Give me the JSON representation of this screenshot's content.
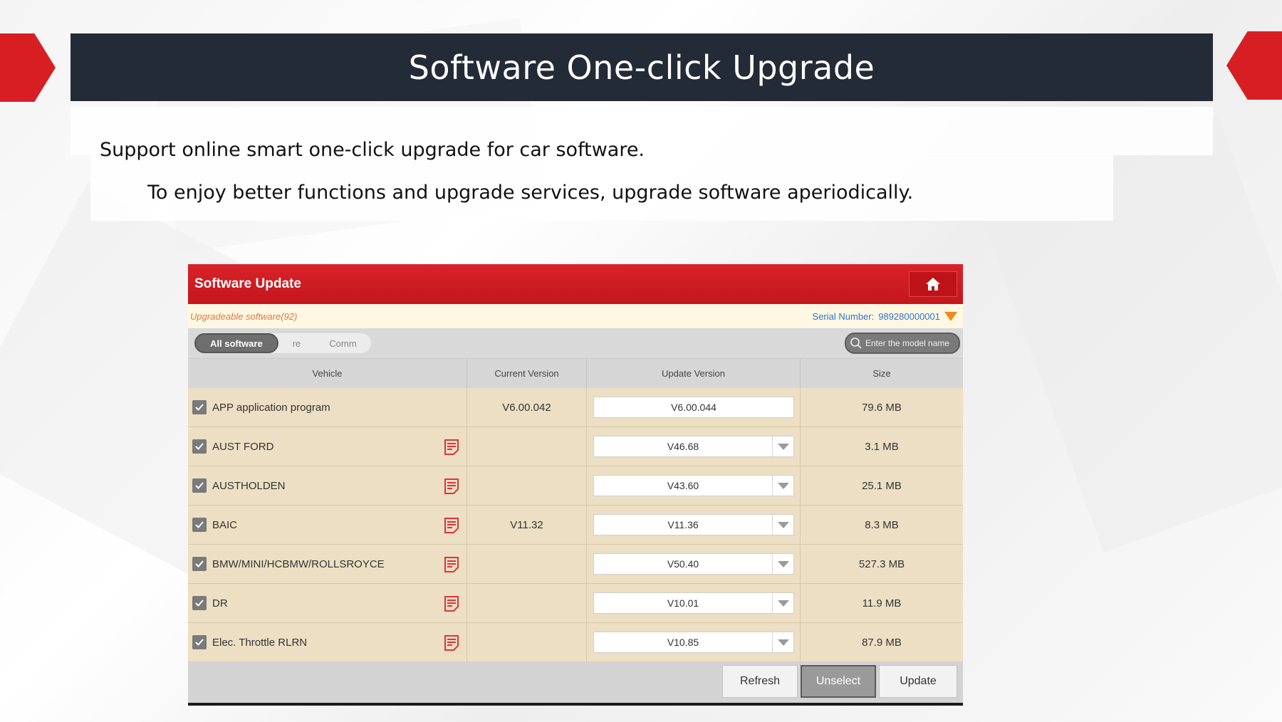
{
  "slide": {
    "title": "Software One-click Upgrade",
    "line1": "Support online smart one-click upgrade for car software.",
    "line2": "To enjoy better functions and upgrade services, upgrade software aperiodically."
  },
  "app": {
    "header_title": "Software Update",
    "home_icon": "home-icon",
    "upgradeable_text": "Upgradeable software(92)",
    "serial_label": "Serial Number:",
    "serial_value": "989280000001",
    "filters": [
      "All software",
      "re",
      "Comm"
    ],
    "search_placeholder": "Enter the model name",
    "columns": [
      "Vehicle",
      "Current Version",
      "Update Version",
      "Size"
    ],
    "rows": [
      {
        "vehicle": "APP application program",
        "current": "V6.00.042",
        "update": "V6.00.044",
        "size": "79.6 MB",
        "checked": true,
        "has_note": false,
        "dropdown": false
      },
      {
        "vehicle": "AUST FORD",
        "current": "",
        "update": "V46.68",
        "size": "3.1 MB",
        "checked": true,
        "has_note": true,
        "dropdown": true
      },
      {
        "vehicle": "AUSTHOLDEN",
        "current": "",
        "update": "V43.60",
        "size": "25.1 MB",
        "checked": true,
        "has_note": true,
        "dropdown": true
      },
      {
        "vehicle": "BAIC",
        "current": "V11.32",
        "update": "V11.36",
        "size": "8.3 MB",
        "checked": true,
        "has_note": true,
        "dropdown": true
      },
      {
        "vehicle": "BMW/MINI/HCBMW/ROLLSROYCE",
        "current": "",
        "update": "V50.40",
        "size": "527.3 MB",
        "checked": true,
        "has_note": true,
        "dropdown": true
      },
      {
        "vehicle": "DR",
        "current": "",
        "update": "V10.01",
        "size": "11.9 MB",
        "checked": true,
        "has_note": true,
        "dropdown": true
      },
      {
        "vehicle": "Elec. Throttle RLRN",
        "current": "",
        "update": "V10.85",
        "size": "87.9 MB",
        "checked": true,
        "has_note": true,
        "dropdown": true
      }
    ],
    "buttons": {
      "refresh": "Refresh",
      "unselect": "Unselect",
      "update": "Update"
    },
    "colors": {
      "header_red": "#d9222a",
      "row_bg": "#ecdfc3",
      "accent_orange": "#f08a1c",
      "serial_blue": "#2f76c8"
    }
  }
}
